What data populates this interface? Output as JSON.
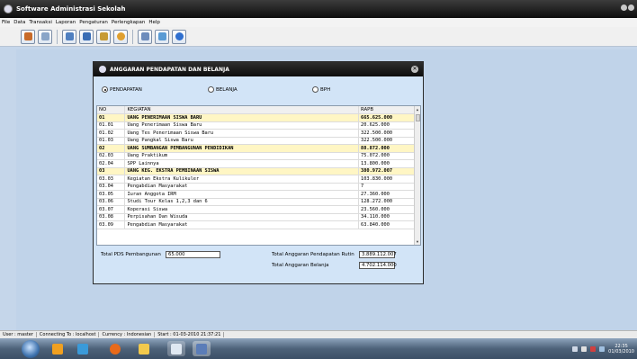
{
  "app": {
    "title": "Software Administrasi Sekolah"
  },
  "menu": [
    "File",
    "Data",
    "Transaksi",
    "Laporan",
    "Pengaturan",
    "Perlengkapan",
    "Help"
  ],
  "toolbar_icons": [
    "user-icon",
    "card-icon",
    "book-icon",
    "network-icon",
    "coins-icon",
    "gear-icon",
    "tools-icon",
    "edit-icon",
    "help-icon"
  ],
  "dialog": {
    "title": "ANGGARAN PENDAPATAN DAN BELANJA",
    "radios": [
      {
        "label": "PENDAPATAN",
        "selected": true
      },
      {
        "label": "BELANJA",
        "selected": false
      },
      {
        "label": "BPH",
        "selected": false
      }
    ],
    "table": {
      "headers": [
        "NO",
        "KEGIATAN",
        "RAPB"
      ],
      "rows": [
        {
          "no": "01",
          "kegiatan": "UANG PENERIMAAN SISWA BARU",
          "rapb": "665.625.000",
          "group": true
        },
        {
          "no": "01.01",
          "kegiatan": "Uang Penerimaan Siswa Baru",
          "rapb": "20.625.000",
          "group": false
        },
        {
          "no": "01.02",
          "kegiatan": "Uang Tes Penerimaan Siswa Baru",
          "rapb": "322.500.000",
          "group": false
        },
        {
          "no": "01.03",
          "kegiatan": "Uang Pangkal Siswa Baru",
          "rapb": "322.500.000",
          "group": false
        },
        {
          "no": "02",
          "kegiatan": "UANG SUMBANGAN PEMBANGUNAN PENDIDIKAN",
          "rapb": "88.872.000",
          "group": true
        },
        {
          "no": "02.03",
          "kegiatan": "Uang Praktikum",
          "rapb": "75.072.000",
          "group": false
        },
        {
          "no": "02.04",
          "kegiatan": "SPP Lainnya",
          "rapb": "13.800.000",
          "group": false
        },
        {
          "no": "03",
          "kegiatan": "UANG KEG. EKSTRA  PEMBINAAN SISWA",
          "rapb": "380.972.007",
          "group": true
        },
        {
          "no": "03.03",
          "kegiatan": "Kegiatan Ekstra Kulikuler",
          "rapb": "103.830.000",
          "group": false
        },
        {
          "no": "03.04",
          "kegiatan": "Pengabdian Masyarakat",
          "rapb": "7",
          "group": false
        },
        {
          "no": "03.05",
          "kegiatan": "Iuran Anggota IRM",
          "rapb": "27.360.000",
          "group": false
        },
        {
          "no": "03.06",
          "kegiatan": "Studi Tour Kelas 1,2,3 dan 6",
          "rapb": "128.272.000",
          "group": false
        },
        {
          "no": "03.07",
          "kegiatan": "Koperasi Siswa",
          "rapb": "23.560.000",
          "group": false
        },
        {
          "no": "03.08",
          "kegiatan": "Perpisahan Dan Wisuda",
          "rapb": "34.110.000",
          "group": false
        },
        {
          "no": "03.09",
          "kegiatan": "Pengabdian Masyarakat",
          "rapb": "63.840.000",
          "group": false
        }
      ]
    },
    "totals": {
      "pds_label": "Total PDS Pembangunan",
      "pds_value": "65.000",
      "rutin_label": "Total Anggaran Pendapatan Rutin",
      "rutin_value": "3.889.112.007",
      "belanja_label": "Total Anggaran Belanja",
      "belanja_value": "4.702.114.000"
    }
  },
  "statusbar": {
    "user": "User : master",
    "connecting": "Connecting To : localhost",
    "currency": "Currency : Indonesian",
    "start": "Start : 01-03-2010 21:37:21"
  },
  "taskbar": {
    "icons": [
      "windows-start-icon",
      "media-player-icon",
      "network-app-icon",
      "firefox-icon",
      "folder-icon",
      "calculator-icon",
      "app-window-icon"
    ],
    "clock_time": "22:35",
    "clock_date": "01/03/2010"
  },
  "colors": {
    "group_row": "#fff6c4",
    "dialog_bg": "#d2e4f7",
    "workspace_bg": "#c0d3e9",
    "titlebar": "#1a1a1a"
  }
}
